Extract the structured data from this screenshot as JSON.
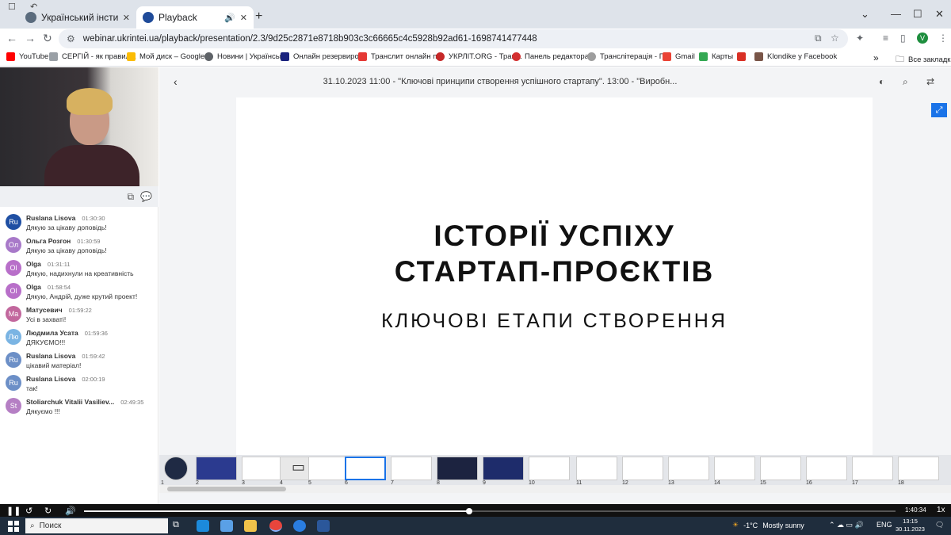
{
  "browser": {
    "tabs": [
      {
        "label": "Український інститут науково-",
        "favicon_color": "#5a6b7d",
        "active": false
      },
      {
        "label": "Playback",
        "favicon_color": "#1f4b99",
        "active": true
      }
    ],
    "address": "webinar.ukrintei.ua/playback/presentation/2.3/9d25c2871e8718b903c3c66665c4c5928b92ad61-1698741477448",
    "profile_initial": "V",
    "bookmarks": [
      {
        "label": "YouTube",
        "color": "#ff0000"
      },
      {
        "label": "СЕРГІЙ - як правил...",
        "color": "#9aa0a6"
      },
      {
        "label": "Мой диск – Google...",
        "color": "#fbbc04"
      },
      {
        "label": "Новини | Українськ...",
        "color": "#5f6368"
      },
      {
        "label": "Онлайн резервиро...",
        "color": "#1a237e"
      },
      {
        "label": "Транслит онлайн п...",
        "color": "#e53935"
      },
      {
        "label": "УКРЛІТ.ORG - Тран...",
        "color": "#c62828"
      },
      {
        "label": "Панель редактора...",
        "color": "#d32f2f"
      },
      {
        "label": "Транслітерація - П...",
        "color": "#9e9e9e"
      },
      {
        "label": "Gmail",
        "color": "#ea4335"
      },
      {
        "label": "Карты",
        "color": "#34a853"
      },
      {
        "label": "",
        "color": "#d93025"
      },
      {
        "label": "Klondike у Facebook",
        "color": "#795548"
      }
    ],
    "all_bookmarks": "Все закладки"
  },
  "chat": {
    "messages": [
      {
        "initials": "Ru",
        "name": "Ruslana Lisova",
        "time": "01:30:30",
        "text": "Дякую за цікаву доповідь!",
        "color": "#1f4fa3"
      },
      {
        "initials": "Ол",
        "name": "Ольга Розгон",
        "time": "01:30:59",
        "text": "Дякую за цікаву доповідь!",
        "color": "#a879c9"
      },
      {
        "initials": "Ol",
        "name": "Olga",
        "time": "01:31:11",
        "text": "Дякую, надихнули на креативність",
        "color": "#b86fc9"
      },
      {
        "initials": "Ol",
        "name": "Olga",
        "time": "01:58:54",
        "text": "Дякую, Андрій, дуже крутий проект!",
        "color": "#b86fc9"
      },
      {
        "initials": "Ма",
        "name": "Матусевич",
        "time": "01:59:22",
        "text": "Усі в захваті!",
        "color": "#c2679d"
      },
      {
        "initials": "Лю",
        "name": "Людмила Усата",
        "time": "01:59:36",
        "text": "ДЯКУЄМО!!!",
        "color": "#7ab4e3"
      },
      {
        "initials": "Ru",
        "name": "Ruslana Lisova",
        "time": "01:59:42",
        "text": "цікавий матеріал!",
        "color": "#6c8fc7"
      },
      {
        "initials": "Ru",
        "name": "Ruslana Lisova",
        "time": "02:00:19",
        "text": "так!",
        "color": "#6c8fc7"
      },
      {
        "initials": "St",
        "name": "Stoliarchuk Vitalii Vasiliev...",
        "time": "02:49:35",
        "text": "Дякуємо !!!",
        "color": "#b57fc4"
      }
    ]
  },
  "presentation": {
    "title": "31.10.2023 11:00 - \"Ключові принципи створення успішного стартапу\". 13:00 - \"Виробн...",
    "slide": {
      "title_line1": "ІСТОРІЇ УСПІХУ",
      "title_line2": "СТАРТАП-ПРОЄКТІВ",
      "subtitle": "КЛЮЧОВІ ЕТАПИ СТВОРЕННЯ"
    },
    "thumbnails": [
      "1",
      "2",
      "3",
      "4",
      "5",
      "6",
      "7",
      "8",
      "9",
      "10",
      "11",
      "12",
      "13",
      "14",
      "15",
      "16",
      "17",
      "18"
    ],
    "selected_thumbnail": "6"
  },
  "player": {
    "time": "1:40:34",
    "speed": "1x",
    "progress": 0.475
  },
  "taskbar": {
    "search_placeholder": "Поиск",
    "temperature": "-1°C",
    "weather": "Mostly sunny",
    "lang": "ENG",
    "time": "13:15",
    "date": "30.11.2023"
  }
}
